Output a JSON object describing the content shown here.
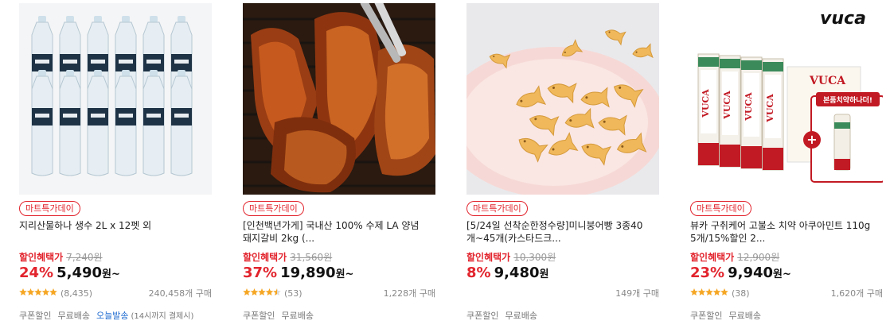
{
  "products": [
    {
      "image_alt": "지리산물하나 생수 bottles",
      "badge": "마트특가데이",
      "title_lines": [
        "지리산물하나 생수 2L x 12펫 외"
      ],
      "benefit_label": "할인혜택가",
      "original_price": "7,240원",
      "discount": "24%",
      "price": "5,490",
      "price_unit": "원~",
      "rating": 5,
      "review_count": "(8,435)",
      "sold_count": "240,458개 구매",
      "tags": [
        "쿠폰할인",
        "무료배송"
      ],
      "delivery_tag": "오늘발송",
      "delivery_note": "(14시까지 결제시)"
    },
    {
      "image_alt": "LA 양념 돼지갈비",
      "badge": "마트특가데이",
      "title_lines": [
        "[인천백년가게] 국내산 100% 수제 LA 양념",
        "돼지갈비 2kg (..."
      ],
      "benefit_label": "할인혜택가",
      "original_price": "31,560원",
      "discount": "37%",
      "price": "19,890",
      "price_unit": "원~",
      "rating": 4.5,
      "review_count": "(53)",
      "sold_count": "1,228개 구매",
      "tags": [
        "쿠폰할인",
        "무료배송"
      ]
    },
    {
      "image_alt": "미니붕어빵 on plate",
      "badge": "마트특가데이",
      "title_lines": [
        "[5/24일 선착순한정수량]미니붕어빵 3종40",
        "개~45개(카스타드크..."
      ],
      "benefit_label": "할인혜택가",
      "original_price": "10,300원",
      "discount": "8%",
      "price": "9,480",
      "price_unit": "원",
      "sold_count": "149개 구매",
      "tags": [
        "쿠폰할인",
        "무료배송"
      ]
    },
    {
      "image_alt": "뷰카 치약 set",
      "image_brand": "vuca",
      "image_tube_label": "VUCA",
      "image_banner": "본품치약하나더!",
      "badge": "마트특가데이",
      "title_lines": [
        "뷰카 구취케어 고불소 치약 아쿠아민트 110g",
        "5개/15%할인 2..."
      ],
      "benefit_label": "할인혜택가",
      "original_price": "12,900원",
      "discount": "23%",
      "price": "9,940",
      "price_unit": "원~",
      "rating": 5,
      "review_count": "(38)",
      "sold_count": "1,620개 구매",
      "tags": [
        "쿠폰할인",
        "무료배송"
      ]
    }
  ],
  "colors": {
    "accent_red": "#e2242d",
    "star": "#f5a623",
    "delivery_blue": "#1f6bd1"
  }
}
